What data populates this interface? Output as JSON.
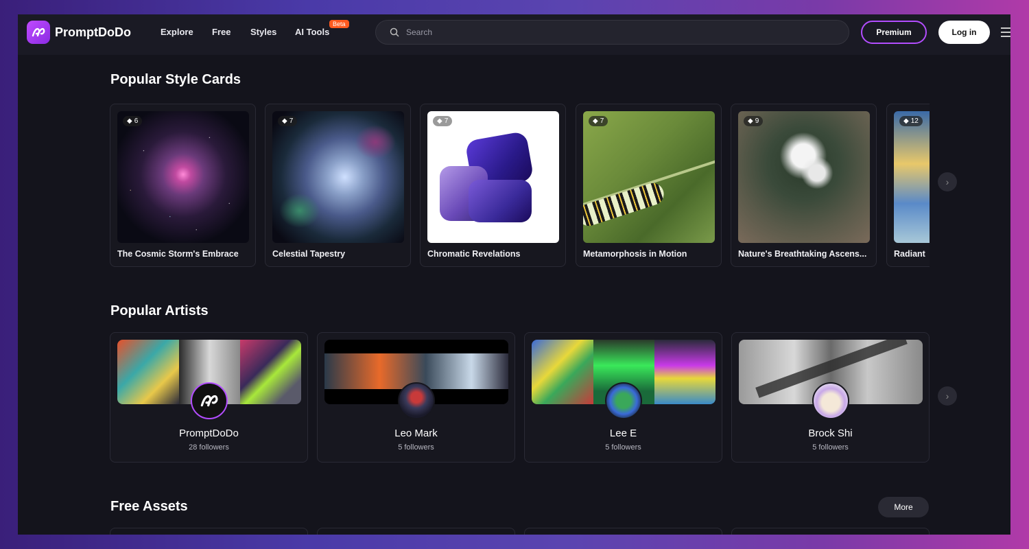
{
  "brand": {
    "name": "PromptDoDo"
  },
  "nav": {
    "links": [
      "Explore",
      "Free",
      "Styles",
      "AI Tools"
    ],
    "beta_badge": "Beta",
    "search_placeholder": "Search",
    "premium_label": "Premium",
    "login_label": "Log in"
  },
  "sections": {
    "style_cards_title": "Popular Style Cards",
    "artists_title": "Popular Artists",
    "free_assets_title": "Free Assets",
    "more_label": "More"
  },
  "style_cards": [
    {
      "name": "The Cosmic Storm's Embrace",
      "count": "6"
    },
    {
      "name": "Celestial Tapestry",
      "count": "7"
    },
    {
      "name": "Chromatic Revelations",
      "count": "7"
    },
    {
      "name": "Metamorphosis in Motion",
      "count": "7"
    },
    {
      "name": "Nature's Breathtaking Ascens...",
      "count": "9"
    },
    {
      "name": "Radiant",
      "count": "12"
    }
  ],
  "artists": [
    {
      "name": "PromptDoDo",
      "followers": "28 followers"
    },
    {
      "name": "Leo Mark",
      "followers": "5 followers"
    },
    {
      "name": "Lee E",
      "followers": "5 followers"
    },
    {
      "name": "Brock Shi",
      "followers": "5 followers"
    }
  ],
  "colors": {
    "accent": "#b34dff",
    "beta": "#ff5a1f",
    "background": "#14141c"
  }
}
